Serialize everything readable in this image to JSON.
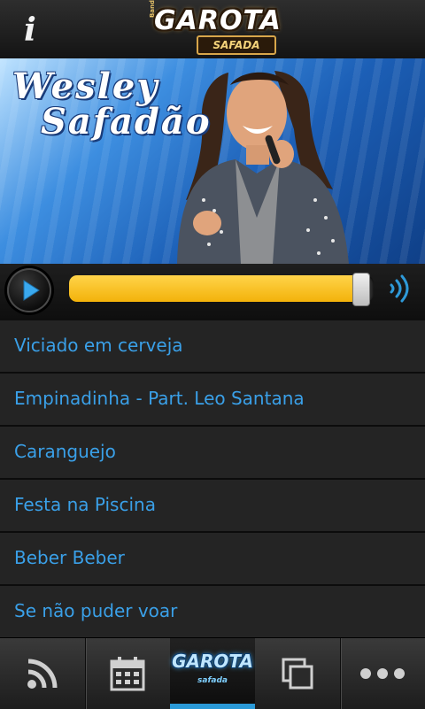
{
  "header": {
    "info_label": "i",
    "logo_small": "Banda",
    "logo_main": "GAROTA",
    "logo_sub": "SAFADA"
  },
  "banner": {
    "title_line1": "Wesley",
    "title_line2": "Safadão"
  },
  "player": {
    "progress": 0.96,
    "accent": "#f3b20a",
    "icon_play": "play-icon",
    "icon_volume": "volume-icon"
  },
  "tracks": [
    "Viciado em cerveja",
    "Empinadinha - Part. Leo Santana",
    "Caranguejo",
    "Festa na Piscina",
    "Beber Beber",
    "Se não puder voar"
  ],
  "tabbar": {
    "active_index": 2,
    "active_color": "#2a9ad8",
    "tabs": [
      {
        "icon": "rss-icon"
      },
      {
        "icon": "calendar-icon"
      },
      {
        "icon": "garota-logo",
        "label": "GAROTA",
        "sub": "safada"
      },
      {
        "icon": "copy-icon"
      },
      {
        "icon": "more-icon"
      }
    ]
  }
}
